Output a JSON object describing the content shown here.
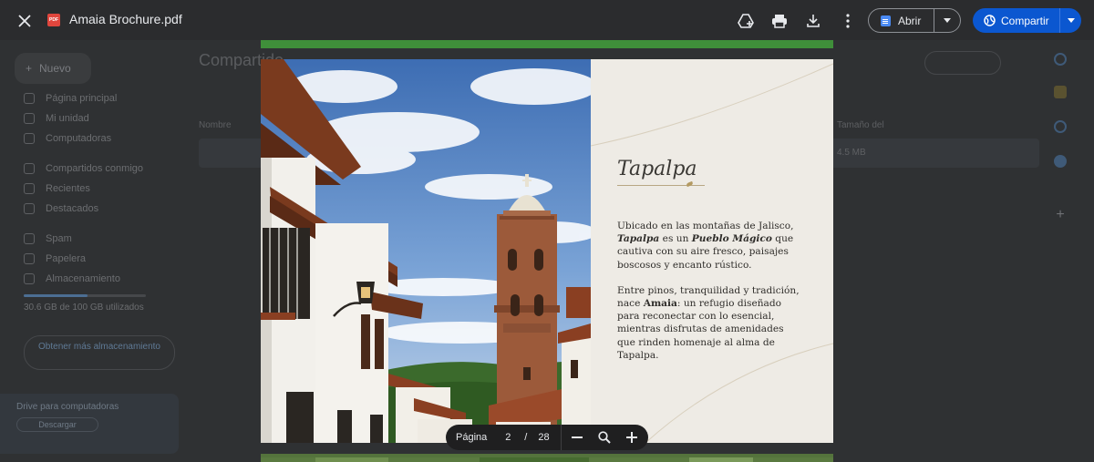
{
  "viewer": {
    "file_name": "Amaia Brochure.pdf",
    "file_type_badge": "PDF",
    "open_label": "Abrir",
    "share_label": "Compartir",
    "icons": [
      "close-icon",
      "add-to-drive-icon",
      "print-icon",
      "download-icon",
      "more-vert-icon",
      "chevron-down-icon",
      "share-globe-icon"
    ],
    "accent_color": "#0b57d0"
  },
  "page_content": {
    "title": "Tapalpa",
    "paragraph1_a": "Ubicado en las montañas de Jalisco, ",
    "paragraph1_b": "Tapalpa",
    "paragraph1_c": " es un ",
    "paragraph1_d": "Pueblo Mágico",
    "paragraph1_e": " que cautiva con su aire fresco, paisajes boscosos y encanto rústico.",
    "paragraph2_a": "Entre pinos, tranquilidad y tradición, nace ",
    "paragraph2_b": "Amaia",
    "paragraph2_c": ": un refugio diseñado para reconectar con lo esencial, mientras disfrutas de amenidades que rinden homenaje al alma de Tapalpa."
  },
  "pager": {
    "page_label": "Página",
    "current_page": "2",
    "separator": "/",
    "total_pages": "28"
  },
  "background_drive": {
    "new_label": "Nuevo",
    "page_title": "Compartido",
    "nav": [
      "Página principal",
      "Mi unidad",
      "Computadoras",
      "Compartidos conmigo",
      "Recientes",
      "Destacados",
      "Spam",
      "Papelera",
      "Almacenamiento"
    ],
    "storage_text": "30.6 GB de 100 GB utilizados",
    "get_more_label": "Obtener más almacenamiento",
    "toast_title": "Drive para computadoras",
    "toast_button": "Descargar",
    "column_name": "Nombre",
    "column_size": "Tamaño del",
    "row_size": "4.5 MB"
  }
}
